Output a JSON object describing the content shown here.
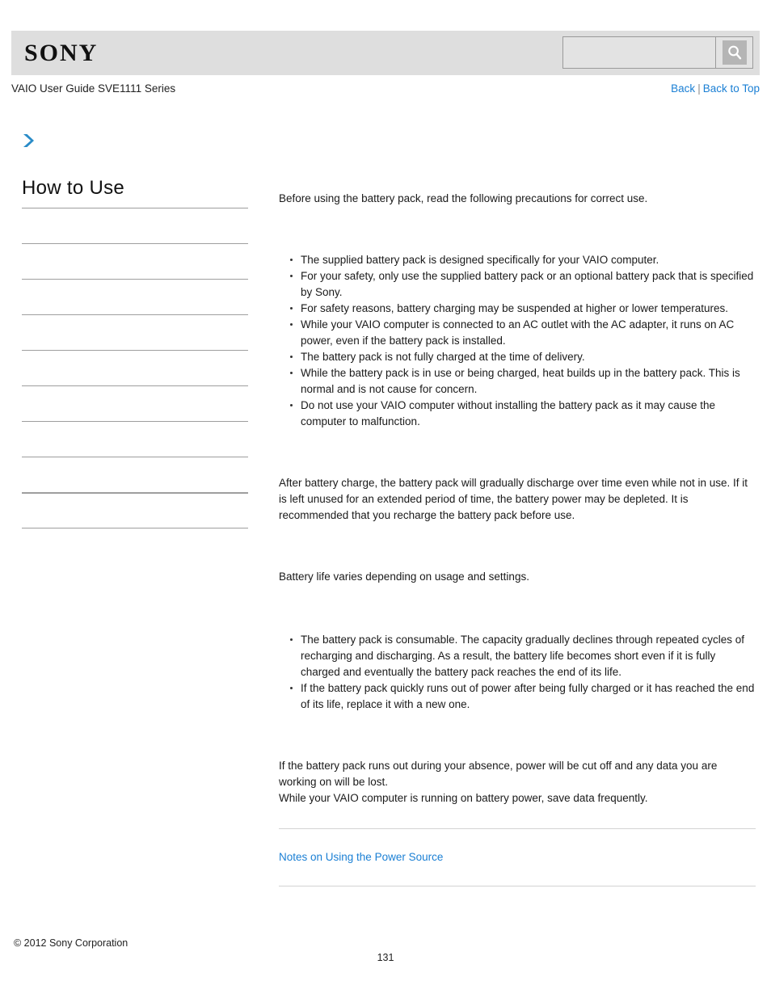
{
  "header": {
    "logo": "SONY",
    "search": {
      "value": "",
      "placeholder": "",
      "icon": "search-icon",
      "button_label": ""
    }
  },
  "subheader": {
    "guide_title": "VAIO User Guide SVE1111 Series",
    "links": [
      {
        "label": "Back"
      },
      {
        "label": "Back to Top"
      }
    ],
    "separator": "|"
  },
  "breadcrumb_icon": "chevron-right-icon",
  "sidebar": {
    "title": "How to Use",
    "items": [
      {
        "label": ""
      },
      {
        "label": ""
      },
      {
        "label": ""
      },
      {
        "label": ""
      },
      {
        "label": ""
      },
      {
        "label": ""
      },
      {
        "label": ""
      },
      {
        "label": ""
      },
      {
        "label": ""
      },
      {
        "label": ""
      }
    ]
  },
  "main": {
    "intro": "Before using the battery pack, read the following precautions for correct use.",
    "precautions": [
      "The supplied battery pack is designed specifically for your VAIO computer.",
      "For your safety, only use the supplied battery pack or an optional battery pack that is specified by Sony.",
      "For safety reasons, battery charging may be suspended at higher or lower temperatures.",
      "While your VAIO computer is connected to an AC outlet with the AC adapter, it runs on AC power, even if the battery pack is installed.",
      "The battery pack is not fully charged at the time of delivery.",
      "While the battery pack is in use or being charged, heat builds up in the battery pack. This is normal and is not cause for concern.",
      "Do not use your VAIO computer without installing the battery pack as it may cause the computer to malfunction."
    ],
    "discharge_paragraph": "After battery charge, the battery pack will gradually discharge over time even while not in use. If it is left unused for an extended period of time, the battery power may be depleted. It is recommended that you recharge the battery pack before use.",
    "battery_life_paragraph": "Battery life varies depending on usage and settings.",
    "consumable_list": [
      "The battery pack is consumable. The capacity gradually declines through repeated cycles of recharging and discharging. As a result, the battery life becomes short even if it is fully charged and eventually the battery pack reaches the end of its life.",
      "If the battery pack quickly runs out of power after being fully charged or it has reached the end of its life, replace it with a new one."
    ],
    "power_loss_paragraph_1": "If the battery pack runs out during your absence, power will be cut off and any data you are working on will be lost.",
    "power_loss_paragraph_2": "While your VAIO computer is running on battery power, save data frequently.",
    "related_link": "Notes on Using the Power Source"
  },
  "footer": {
    "copyright": "© 2012 Sony Corporation",
    "page_number": "131"
  },
  "colors": {
    "header_bg": "#dedede",
    "link_blue": "#1a7fd4",
    "chevron_blue": "#2a8cc8",
    "rule_gray": "#9e9e9e"
  }
}
